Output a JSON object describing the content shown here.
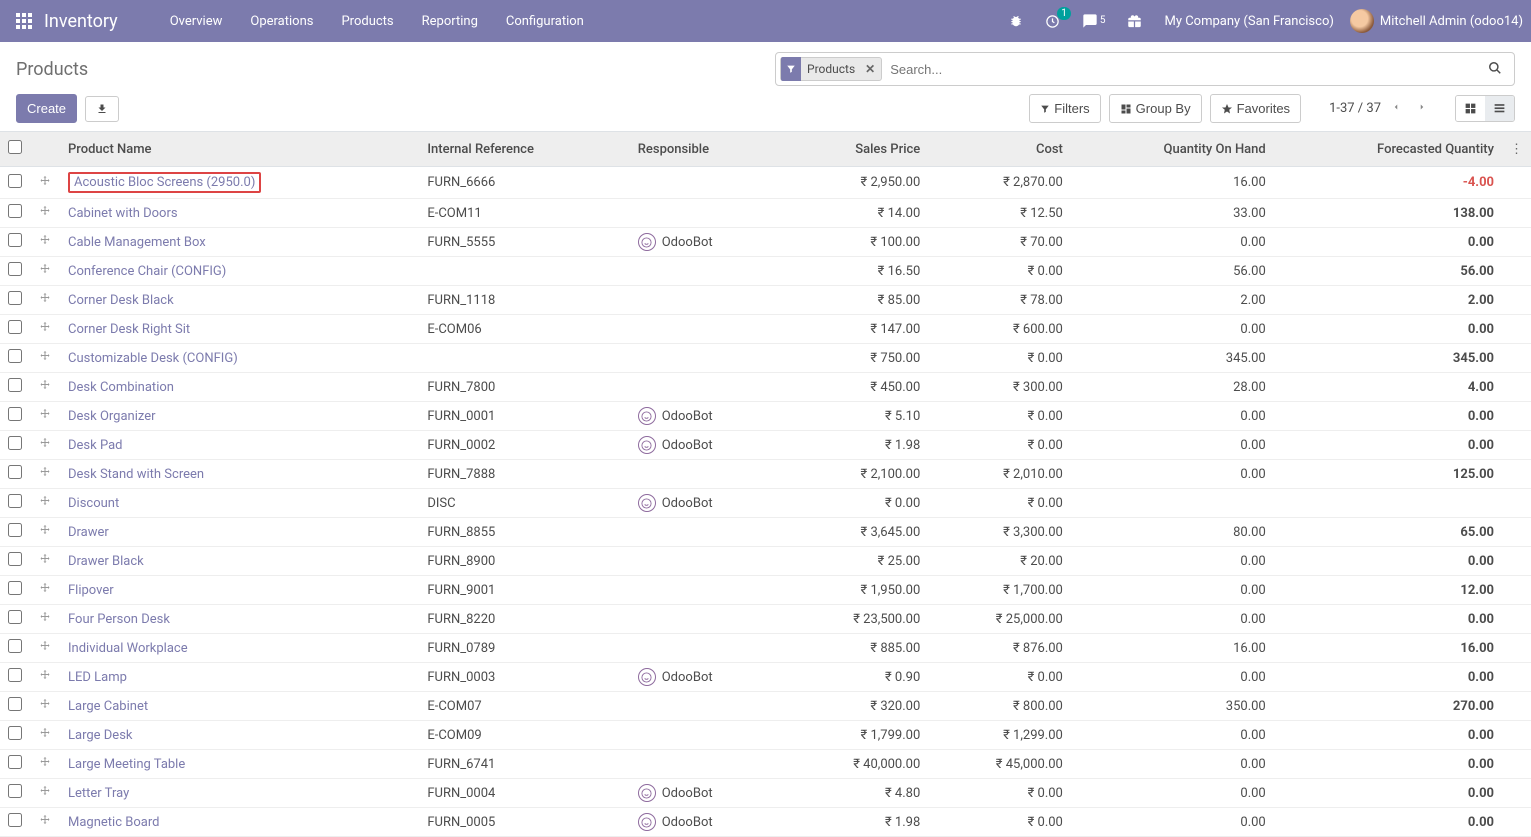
{
  "navbar": {
    "brand": "Inventory",
    "menu": [
      "Overview",
      "Operations",
      "Products",
      "Reporting",
      "Configuration"
    ],
    "activity_badge": "1",
    "chat_badge": "5",
    "company": "My Company (San Francisco)",
    "user": "Mitchell Admin (odoo14)"
  },
  "breadcrumb": "Products",
  "search": {
    "facet_label": "Products",
    "placeholder": "Search..."
  },
  "buttons": {
    "create": "Create",
    "filters": "Filters",
    "groupby": "Group By",
    "favorites": "Favorites"
  },
  "pager": {
    "range": "1-37 / 37"
  },
  "columns": {
    "name": "Product Name",
    "ref": "Internal Reference",
    "resp": "Responsible",
    "price": "Sales Price",
    "cost": "Cost",
    "onhand": "Quantity On Hand",
    "forecast": "Forecasted Quantity"
  },
  "rows": [
    {
      "name": "Acoustic Bloc Screens (2950.0)",
      "ref": "FURN_6666",
      "resp": "",
      "price": "₹ 2,950.00",
      "cost": "₹ 2,870.00",
      "onhand": "16.00",
      "forecast": "-4.00",
      "neg": true,
      "hl": true
    },
    {
      "name": "Cabinet with Doors",
      "ref": "E-COM11",
      "resp": "",
      "price": "₹ 14.00",
      "cost": "₹ 12.50",
      "onhand": "33.00",
      "forecast": "138.00"
    },
    {
      "name": "Cable Management Box",
      "ref": "FURN_5555",
      "resp": "OdooBot",
      "price": "₹ 100.00",
      "cost": "₹ 70.00",
      "onhand": "0.00",
      "forecast": "0.00"
    },
    {
      "name": "Conference Chair (CONFIG)",
      "ref": "",
      "resp": "",
      "price": "₹ 16.50",
      "cost": "₹ 0.00",
      "onhand": "56.00",
      "forecast": "56.00"
    },
    {
      "name": "Corner Desk Black",
      "ref": "FURN_1118",
      "resp": "",
      "price": "₹ 85.00",
      "cost": "₹ 78.00",
      "onhand": "2.00",
      "forecast": "2.00"
    },
    {
      "name": "Corner Desk Right Sit",
      "ref": "E-COM06",
      "resp": "",
      "price": "₹ 147.00",
      "cost": "₹ 600.00",
      "onhand": "0.00",
      "forecast": "0.00"
    },
    {
      "name": "Customizable Desk (CONFIG)",
      "ref": "",
      "resp": "",
      "price": "₹ 750.00",
      "cost": "₹ 0.00",
      "onhand": "345.00",
      "forecast": "345.00"
    },
    {
      "name": "Desk Combination",
      "ref": "FURN_7800",
      "resp": "",
      "price": "₹ 450.00",
      "cost": "₹ 300.00",
      "onhand": "28.00",
      "forecast": "4.00"
    },
    {
      "name": "Desk Organizer",
      "ref": "FURN_0001",
      "resp": "OdooBot",
      "price": "₹ 5.10",
      "cost": "₹ 0.00",
      "onhand": "0.00",
      "forecast": "0.00"
    },
    {
      "name": "Desk Pad",
      "ref": "FURN_0002",
      "resp": "OdooBot",
      "price": "₹ 1.98",
      "cost": "₹ 0.00",
      "onhand": "0.00",
      "forecast": "0.00"
    },
    {
      "name": "Desk Stand with Screen",
      "ref": "FURN_7888",
      "resp": "",
      "price": "₹ 2,100.00",
      "cost": "₹ 2,010.00",
      "onhand": "0.00",
      "forecast": "125.00"
    },
    {
      "name": "Discount",
      "ref": "DISC",
      "resp": "OdooBot",
      "price": "₹ 0.00",
      "cost": "₹ 0.00",
      "onhand": "",
      "forecast": ""
    },
    {
      "name": "Drawer",
      "ref": "FURN_8855",
      "resp": "",
      "price": "₹ 3,645.00",
      "cost": "₹ 3,300.00",
      "onhand": "80.00",
      "forecast": "65.00"
    },
    {
      "name": "Drawer Black",
      "ref": "FURN_8900",
      "resp": "",
      "price": "₹ 25.00",
      "cost": "₹ 20.00",
      "onhand": "0.00",
      "forecast": "0.00"
    },
    {
      "name": "Flipover",
      "ref": "FURN_9001",
      "resp": "",
      "price": "₹ 1,950.00",
      "cost": "₹ 1,700.00",
      "onhand": "0.00",
      "forecast": "12.00"
    },
    {
      "name": "Four Person Desk",
      "ref": "FURN_8220",
      "resp": "",
      "price": "₹ 23,500.00",
      "cost": "₹ 25,000.00",
      "onhand": "0.00",
      "forecast": "0.00"
    },
    {
      "name": "Individual Workplace",
      "ref": "FURN_0789",
      "resp": "",
      "price": "₹ 885.00",
      "cost": "₹ 876.00",
      "onhand": "16.00",
      "forecast": "16.00"
    },
    {
      "name": "LED Lamp",
      "ref": "FURN_0003",
      "resp": "OdooBot",
      "price": "₹ 0.90",
      "cost": "₹ 0.00",
      "onhand": "0.00",
      "forecast": "0.00"
    },
    {
      "name": "Large Cabinet",
      "ref": "E-COM07",
      "resp": "",
      "price": "₹ 320.00",
      "cost": "₹ 800.00",
      "onhand": "350.00",
      "forecast": "270.00"
    },
    {
      "name": "Large Desk",
      "ref": "E-COM09",
      "resp": "",
      "price": "₹ 1,799.00",
      "cost": "₹ 1,299.00",
      "onhand": "0.00",
      "forecast": "0.00"
    },
    {
      "name": "Large Meeting Table",
      "ref": "FURN_6741",
      "resp": "",
      "price": "₹ 40,000.00",
      "cost": "₹ 45,000.00",
      "onhand": "0.00",
      "forecast": "0.00"
    },
    {
      "name": "Letter Tray",
      "ref": "FURN_0004",
      "resp": "OdooBot",
      "price": "₹ 4.80",
      "cost": "₹ 0.00",
      "onhand": "0.00",
      "forecast": "0.00"
    },
    {
      "name": "Magnetic Board",
      "ref": "FURN_0005",
      "resp": "OdooBot",
      "price": "₹ 1.98",
      "cost": "₹ 0.00",
      "onhand": "0.00",
      "forecast": "0.00"
    }
  ]
}
